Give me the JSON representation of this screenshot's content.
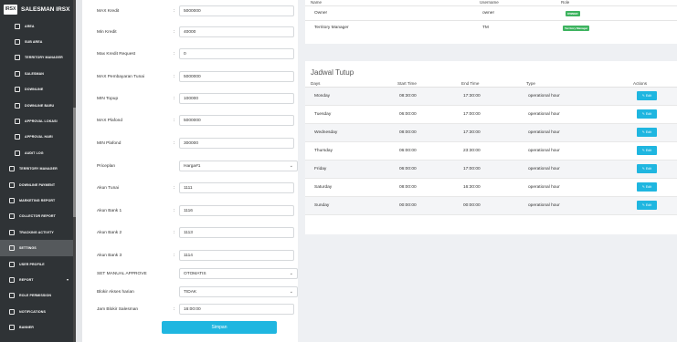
{
  "brand": {
    "logo": "IRSX",
    "title": "SALESMAN IRSX"
  },
  "sidebar": {
    "items": [
      {
        "label": "AREA",
        "icon": "globe-icon"
      },
      {
        "label": "SUB AREA",
        "icon": "layers-icon"
      },
      {
        "label": "TERRITORY MANAGER",
        "icon": "user-tie-icon"
      },
      {
        "label": "SALESMAN",
        "icon": "users-icon"
      },
      {
        "label": "DOWNLINE",
        "icon": "people-icon"
      },
      {
        "label": "DOWNLINE BARU",
        "icon": "user-plus-icon"
      },
      {
        "label": "APPROVAL LOKASI",
        "icon": "location-icon"
      },
      {
        "label": "APPROVAL HARI",
        "icon": "calendar-icon"
      },
      {
        "label": "AUDIT LOG",
        "icon": "log-icon"
      },
      {
        "label": "TERRITORY MANAGER",
        "icon": "user-tie-icon"
      },
      {
        "label": "DOWNLINE PAYMENT",
        "icon": "payment-icon"
      },
      {
        "label": "MARKETING REPORT",
        "icon": "report-icon"
      },
      {
        "label": "COLLECTOR REPORT",
        "icon": "report-icon"
      },
      {
        "label": "TRACKING ACTIVITY",
        "icon": "tracking-icon"
      },
      {
        "label": "SETTINGS",
        "icon": "gear-icon"
      },
      {
        "label": "USER PROFILE",
        "icon": "user-icon"
      },
      {
        "label": "REPORT",
        "icon": "chart-icon"
      },
      {
        "label": "ROLE PERMISSION",
        "icon": "key-icon"
      },
      {
        "label": "NOTIFICATIONS",
        "icon": "bell-icon"
      },
      {
        "label": "BANNER",
        "icon": "image-icon"
      }
    ],
    "report_caret": "▾"
  },
  "form": {
    "fields": [
      {
        "label": "MAX Kredit",
        "value": "5000000"
      },
      {
        "label": "Min Kredit",
        "value": "40000"
      },
      {
        "label": "Max Kredit Request",
        "value": "0"
      },
      {
        "label": "MAX Pembayaran Tunai",
        "value": "5000000"
      },
      {
        "label": "MIN Topup",
        "value": "100000"
      },
      {
        "label": "MAX Plafond",
        "value": "5000000"
      },
      {
        "label": "MIN Plafond",
        "value": "300000"
      },
      {
        "label": "Priceplan",
        "value": "Harga#1"
      },
      {
        "label": "Akun Tunai",
        "value": "1111"
      },
      {
        "label": "Akun Bank 1",
        "value": "1116"
      },
      {
        "label": "Akun Bank 2",
        "value": "1113"
      },
      {
        "label": "Akun Bank 3",
        "value": "1114"
      },
      {
        "label": "SET MANUAL APPROVE",
        "value": "OTOMATIS"
      },
      {
        "label": "Blokir Akses harian",
        "value": "TIDAK"
      },
      {
        "label": "Jam Blokir Salesman",
        "value": "16:00:00"
      }
    ],
    "colon": ":",
    "save_label": "Simpan"
  },
  "users": {
    "headers": [
      "Name",
      "Username",
      "Role"
    ],
    "rows": [
      {
        "name": "Owner",
        "username": "owner",
        "role": "OWNER"
      },
      {
        "name": "Territory Manager",
        "username": "TM",
        "role": "Territory Manager"
      }
    ],
    "badge_color": "#3db35f"
  },
  "jadwal": {
    "title": "Jadwal Tutup",
    "headers": [
      "Days",
      "Start Time",
      "End Time",
      "Type",
      "Actions"
    ],
    "rows": [
      {
        "day": "Monday",
        "start": "08:30:00",
        "end": "17:30:00",
        "type": "operational hour"
      },
      {
        "day": "Tuesday",
        "start": "06:00:00",
        "end": "17:00:00",
        "type": "operational hour"
      },
      {
        "day": "Wednesday",
        "start": "08:00:00",
        "end": "17:30:00",
        "type": "operational hour"
      },
      {
        "day": "Thursday",
        "start": "06:00:00",
        "end": "23:30:00",
        "type": "operational hour"
      },
      {
        "day": "Friday",
        "start": "06:00:00",
        "end": "17:00:00",
        "type": "operational hour"
      },
      {
        "day": "Saturday",
        "start": "08:00:00",
        "end": "16:30:00",
        "type": "operational hour"
      },
      {
        "day": "Sunday",
        "start": "00:00:00",
        "end": "00:00:00",
        "type": "operational hour"
      }
    ],
    "edit_label": "Edit",
    "edit_icon": "edit-icon"
  },
  "accent_color": "#1fb6e0"
}
